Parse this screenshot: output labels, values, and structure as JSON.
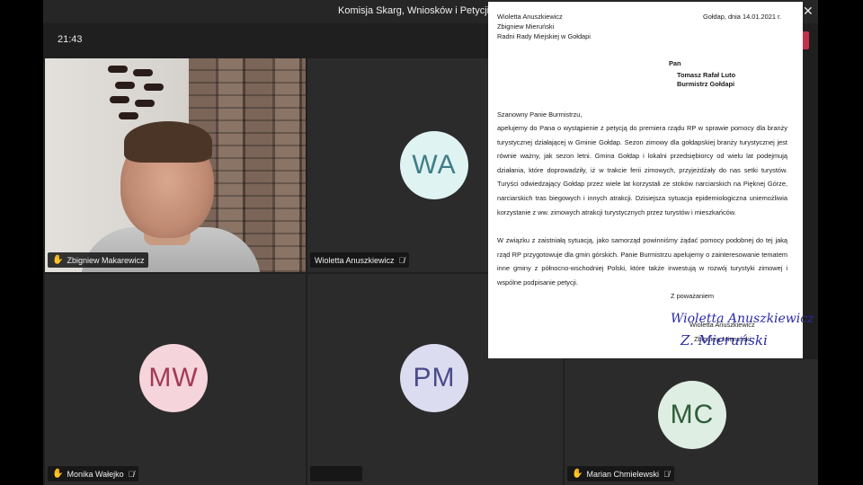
{
  "window": {
    "title": "Komisja Skarg, Wniosków i Petycji w dniu",
    "call_time": "21:43"
  },
  "colors": {
    "app_background": "#1f1f1f",
    "tile_background": "#2b2b2b",
    "leave_button": "#c4314b",
    "raised_hand": "#f5c518"
  },
  "participants": [
    {
      "name": "Zbigniew Makarewicz",
      "hand_raised": true,
      "has_video": true
    },
    {
      "name": "Wioletta Anuszkiewicz",
      "initials": "WA",
      "hand_raised": false,
      "muted": true,
      "avatar_color": "#e0f3f3",
      "initials_color": "#3f7d86"
    },
    {
      "name": "Monika Wałejko",
      "initials": "MW",
      "hand_raised": true,
      "muted": true,
      "avatar_color": "#f6d4dc",
      "initials_color": "#a33a55"
    },
    {
      "name": "",
      "initials": "PM",
      "hand_raised": false,
      "avatar_color": "#dcdcf0",
      "initials_color": "#4a4a8a"
    },
    {
      "name": "Marian Chmielewski",
      "initials": "MC",
      "hand_raised": true,
      "muted": true,
      "avatar_color": "#dfeee2",
      "initials_color": "#2f5d3a"
    }
  ],
  "letter": {
    "sender_lines": [
      "Wioletta Anuszkiewicz",
      "Zbigniew Mieruński",
      "Radni Rady Miejskiej w Gołdapi"
    ],
    "place_date": "Gołdap, dnia 14.01.2021 r.",
    "recipient_lines": [
      "Pan",
      "Tomasz Rafał Luto",
      "Burmistrz Gołdapi"
    ],
    "salutation": "Szanowny Panie Burmistrzu,",
    "paragraph_1": "apelujemy do Pana o wystąpienie z petycją do premiera rządu RP w sprawie pomocy dla branży turystycznej działającej w Gminie Gołdap. Sezon zimowy dla gołdapskiej branży turystycznej jest równie ważny, jak sezon letni. Gmina Gołdap i lokalni przedsiębiorcy od wielu lat podejmują działania, które doprowadziły, iż w trakcie ferii zimowych, przyjeżdżały do nas setki turystów. Turyści odwiedzający Gołdap przez wiele lat korzystali ze stoków narciarskich na Pięknej Górze, narciarskich tras biegowych i innych atrakcji. Dzisiejsza sytuacja epidemiologiczna uniemożliwia korzystanie z ww. zimowych atrakcji turystycznych przez turystów i mieszkańców.",
    "paragraph_2": "W związku z zaistniałą sytuacją, jako samorząd powinniśmy żądać pomocy podobnej do tej jaką rząd RP przygotowuje dla gmin górskich. Panie Burmistrzu apelujemy o zainteresowanie tematem inne gminy z północno-wschodniej Polski, które także inwestują w rozwój turystyki zimowej i wspólne podpisanie petycji.",
    "closing": "Z poważaniem",
    "signature_names": [
      "Wioletta Anuszkiewicz",
      "Zbigniew Mieruński"
    ]
  }
}
